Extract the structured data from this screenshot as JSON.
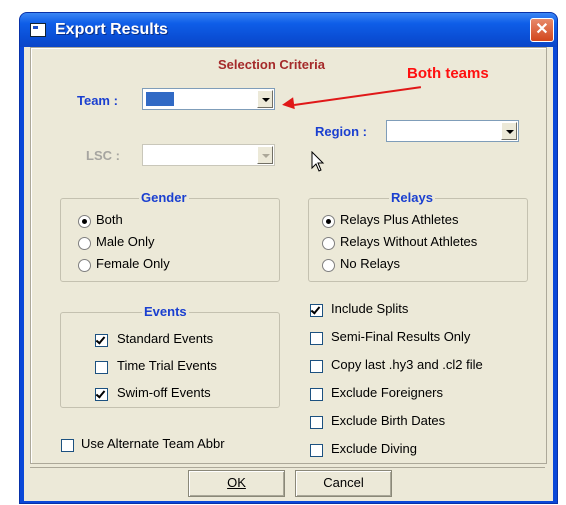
{
  "window": {
    "title": "Export Results"
  },
  "section_heading": "Selection Criteria",
  "annotation": "Both teams",
  "team": {
    "label": "Team :",
    "value": ""
  },
  "lsc": {
    "label": "LSC :",
    "value": ""
  },
  "region": {
    "label": "Region :",
    "value": ""
  },
  "gender": {
    "title": "Gender",
    "options": [
      {
        "label": "Both",
        "selected": true
      },
      {
        "label": "Male Only",
        "selected": false
      },
      {
        "label": "Female Only",
        "selected": false
      }
    ]
  },
  "relays": {
    "title": "Relays",
    "options": [
      {
        "label": "Relays Plus Athletes",
        "selected": true
      },
      {
        "label": "Relays Without Athletes",
        "selected": false
      },
      {
        "label": "No Relays",
        "selected": false
      }
    ]
  },
  "events": {
    "title": "Events",
    "options": [
      {
        "label": "Standard Events",
        "checked": true
      },
      {
        "label": "Time Trial Events",
        "checked": false
      },
      {
        "label": "Swim-off Events",
        "checked": true
      }
    ]
  },
  "alt_team_abbr": {
    "label": "Use Alternate Team Abbr",
    "checked": false
  },
  "options": [
    {
      "label": "Include Splits",
      "checked": true
    },
    {
      "label": "Semi-Final Results Only",
      "checked": false
    },
    {
      "label": "Copy last .hy3 and .cl2 file",
      "checked": false
    },
    {
      "label": "Exclude Foreigners",
      "checked": false
    },
    {
      "label": "Exclude Birth Dates",
      "checked": false
    },
    {
      "label": "Exclude Diving",
      "checked": false
    }
  ],
  "buttons": {
    "ok": "OK",
    "cancel": "Cancel"
  }
}
